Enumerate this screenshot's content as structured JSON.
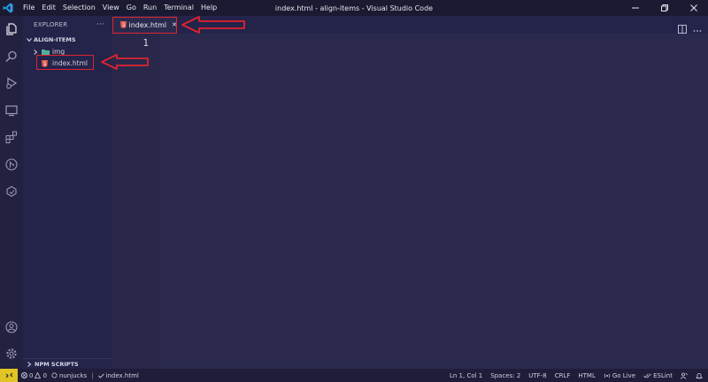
{
  "window": {
    "title": "index.html - align-items - Visual Studio Code",
    "menu": [
      "File",
      "Edit",
      "Selection",
      "View",
      "Go",
      "Run",
      "Terminal",
      "Help"
    ]
  },
  "sidebar": {
    "header": "EXPLORER",
    "more": "···",
    "section": "ALIGN-ITEMS",
    "items": [
      {
        "label": "img",
        "kind": "folder"
      },
      {
        "label": "index.html",
        "kind": "file"
      }
    ],
    "npm_section": "NPM SCRIPTS"
  },
  "editor": {
    "tab_label": "index.html",
    "tab_close": "✕",
    "line_numbers": [
      "1"
    ]
  },
  "statusbar": {
    "errors": "0",
    "warnings": "0",
    "extra": "nunjucks",
    "check_label": "index.html",
    "right": [
      "Ln 1, Col 1",
      "Spaces: 2",
      "UTF-8",
      "CRLF",
      "HTML",
      "Go Live",
      "ESLint"
    ]
  },
  "colors": {
    "titlebar": "#1b1a33",
    "activitybar": "#222140",
    "sidebar": "#24234a",
    "editor": "#2b2a4e",
    "statusbar": "#1e1d3a",
    "remote": "#e2c524",
    "annotation": "#e0232e",
    "html_icon": "#e05a4f",
    "folder_icon": "#4fb39a"
  }
}
